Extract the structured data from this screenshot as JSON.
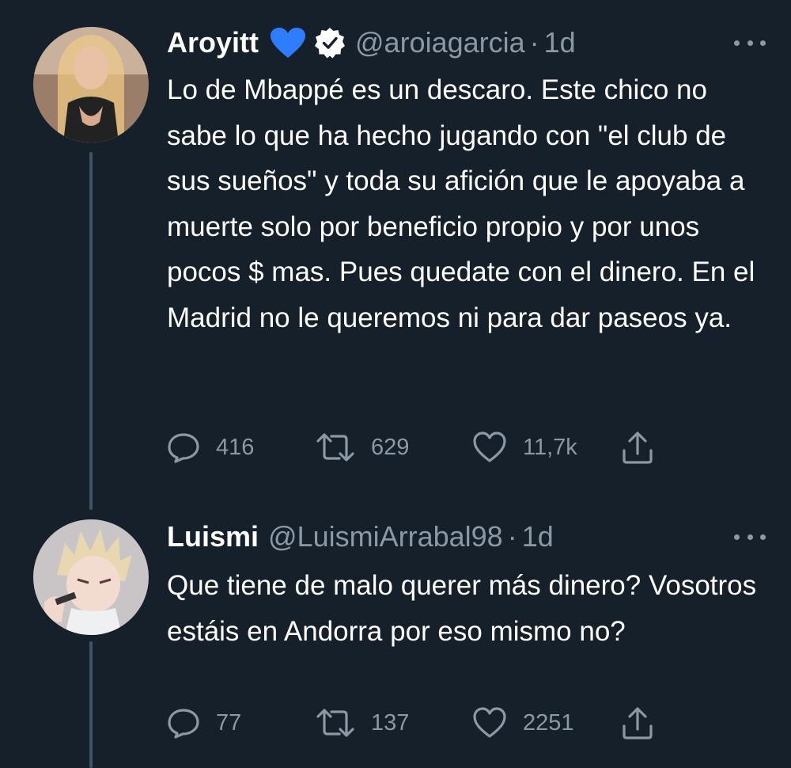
{
  "tweets": [
    {
      "name": "Aroyitt",
      "emoji": "blue-heart",
      "verified": true,
      "handle": "@aroiagarcia",
      "separator": "·",
      "time": "1d",
      "text": "Lo de Mbappé es un descaro. Este chico no sabe lo que ha hecho jugando con \"el club de sus sueños\" y toda su afición que le apoyaba a muerte solo por beneficio propio y por unos pocos $ mas. Pues quedate con el dinero. En el Madrid no le queremos ni para dar paseos ya.",
      "replies": "416",
      "retweets": "629",
      "likes": "11,7k"
    },
    {
      "name": "Luismi",
      "handle": "@LuismiArrabal98",
      "separator": "·",
      "time": "1d",
      "text": "Que tiene de malo querer más dinero? Vosotros estáis en Andorra por eso mismo no?",
      "replies": "77",
      "retweets": "137",
      "likes": "2251"
    }
  ],
  "colors": {
    "background": "#15202b",
    "text": "#ffffff",
    "secondary": "#8b98a5",
    "thread_line": "#3d5466",
    "heart_emoji": "#2f7dff"
  },
  "icons": [
    "blue-heart-emoji",
    "verified-badge-icon",
    "more-icon",
    "reply-icon",
    "retweet-icon",
    "like-icon",
    "share-icon"
  ]
}
